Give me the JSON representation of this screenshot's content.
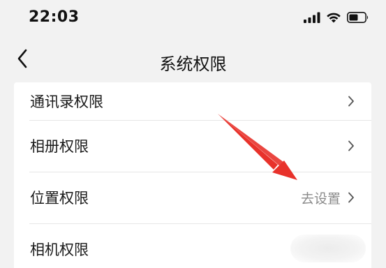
{
  "status_bar": {
    "time": "22:03",
    "icons": [
      "signal-icon",
      "wifi-icon",
      "battery-icon"
    ]
  },
  "nav": {
    "title": "系统权限",
    "back_icon": "chevron-left-icon"
  },
  "list": {
    "items": [
      {
        "label": "通讯录权限",
        "value": ""
      },
      {
        "label": "相册权限",
        "value": ""
      },
      {
        "label": "位置权限",
        "value": "去设置"
      },
      {
        "label": "相机权限",
        "value": ""
      }
    ]
  },
  "colors": {
    "background": "#f2f2f2",
    "card": "#ffffff",
    "text": "#1a1a1a",
    "secondary_text": "#8a8a8a",
    "annotation_arrow": "#e8322b"
  }
}
